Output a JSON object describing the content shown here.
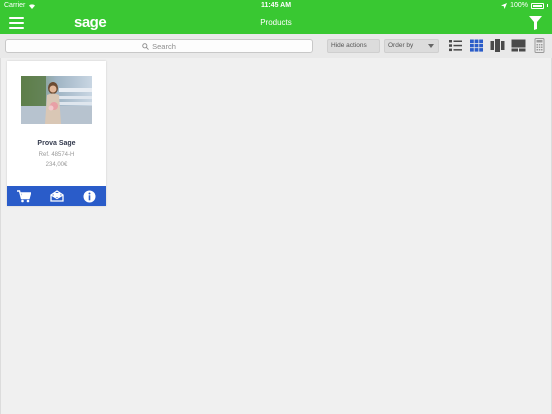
{
  "status_bar": {
    "carrier": "Carrier",
    "time": "11:45 AM",
    "battery": "100%"
  },
  "nav": {
    "logo": "sage",
    "title": "Products",
    "menu_icon": "hamburger-menu-icon",
    "filter_icon": "funnel-filter-icon"
  },
  "toolbar": {
    "search_placeholder": "Search",
    "hide_actions_label": "Hide actions",
    "order_by_label": "Order by",
    "views": [
      "list-view-icon",
      "grid-view-icon",
      "columns-view-icon",
      "tiles-view-icon",
      "calculator-icon"
    ],
    "selected_view": "grid-view-icon"
  },
  "products": [
    {
      "name": "Prova Sage",
      "ref": "Ref. 48574-H",
      "price": "234,00€",
      "actions": [
        "cart-icon",
        "email-icon",
        "info-icon"
      ]
    }
  ],
  "colors": {
    "header_green": "#39c832",
    "action_blue": "#2a5cc9",
    "active_view_blue": "#2a5cc9",
    "icon_gray": "#4a4a4a"
  }
}
